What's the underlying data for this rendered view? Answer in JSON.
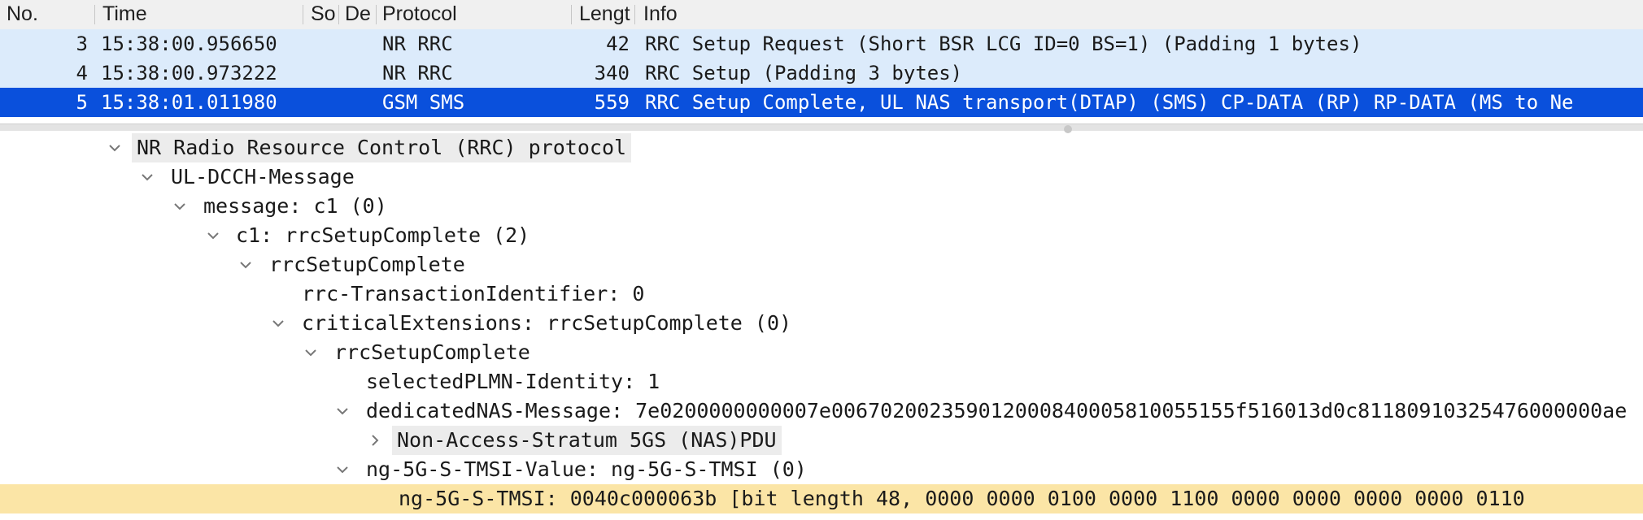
{
  "columns": [
    {
      "label": "No."
    },
    {
      "label": "Time"
    },
    {
      "label": "So"
    },
    {
      "label": "De"
    },
    {
      "label": "Protocol"
    },
    {
      "label": "Lengt"
    },
    {
      "label": "Info"
    }
  ],
  "packets": [
    {
      "no": "3",
      "time": "15:38:00.956650",
      "protocol": "NR RRC",
      "length": "42",
      "info": "RRC Setup Request  (Short BSR LCG ID=0 BS=1)   (Padding 1 bytes)"
    },
    {
      "no": "4",
      "time": "15:38:00.973222",
      "protocol": "NR RRC",
      "length": "340",
      "info": "RRC Setup  (Padding 3 bytes)"
    },
    {
      "no": "5",
      "time": "15:38:01.011980",
      "protocol": "GSM SMS",
      "length": "559",
      "info": "RRC Setup Complete, UL NAS transport(DTAP) (SMS) CP-DATA (RP) RP-DATA (MS to Ne"
    }
  ],
  "tree": [
    {
      "text": "NR Radio Resource Control (RRC) protocol",
      "chevron": "down"
    },
    {
      "text": "UL-DCCH-Message",
      "chevron": "down"
    },
    {
      "text": "message: c1 (0)",
      "chevron": "down"
    },
    {
      "text": "c1: rrcSetupComplete (2)",
      "chevron": "down"
    },
    {
      "text": "rrcSetupComplete",
      "chevron": "down"
    },
    {
      "text": "rrc-TransactionIdentifier: 0",
      "chevron": "none"
    },
    {
      "text": "criticalExtensions: rrcSetupComplete (0)",
      "chevron": "down"
    },
    {
      "text": "rrcSetupComplete",
      "chevron": "down"
    },
    {
      "text": "selectedPLMN-Identity: 1",
      "chevron": "none"
    },
    {
      "text": "dedicatedNAS-Message: 7e0200000000007e006702002359012000840005810055155f516013d0c81180910325476000000ae",
      "chevron": "down"
    },
    {
      "text": "Non-Access-Stratum 5GS (NAS)PDU",
      "chevron": "right"
    },
    {
      "text": "ng-5G-S-TMSI-Value: ng-5G-S-TMSI (0)",
      "chevron": "down"
    },
    {
      "text": "ng-5G-S-TMSI: 0040c000063b [bit length 48, 0000 0000  0100 0000  1100 0000  0000 0000  0000 0110",
      "chevron": "none"
    }
  ],
  "colors": {
    "selected_row": "#0a50dc",
    "alt_row": "#dcebfb",
    "highlight_field": "#fbe5a6"
  }
}
